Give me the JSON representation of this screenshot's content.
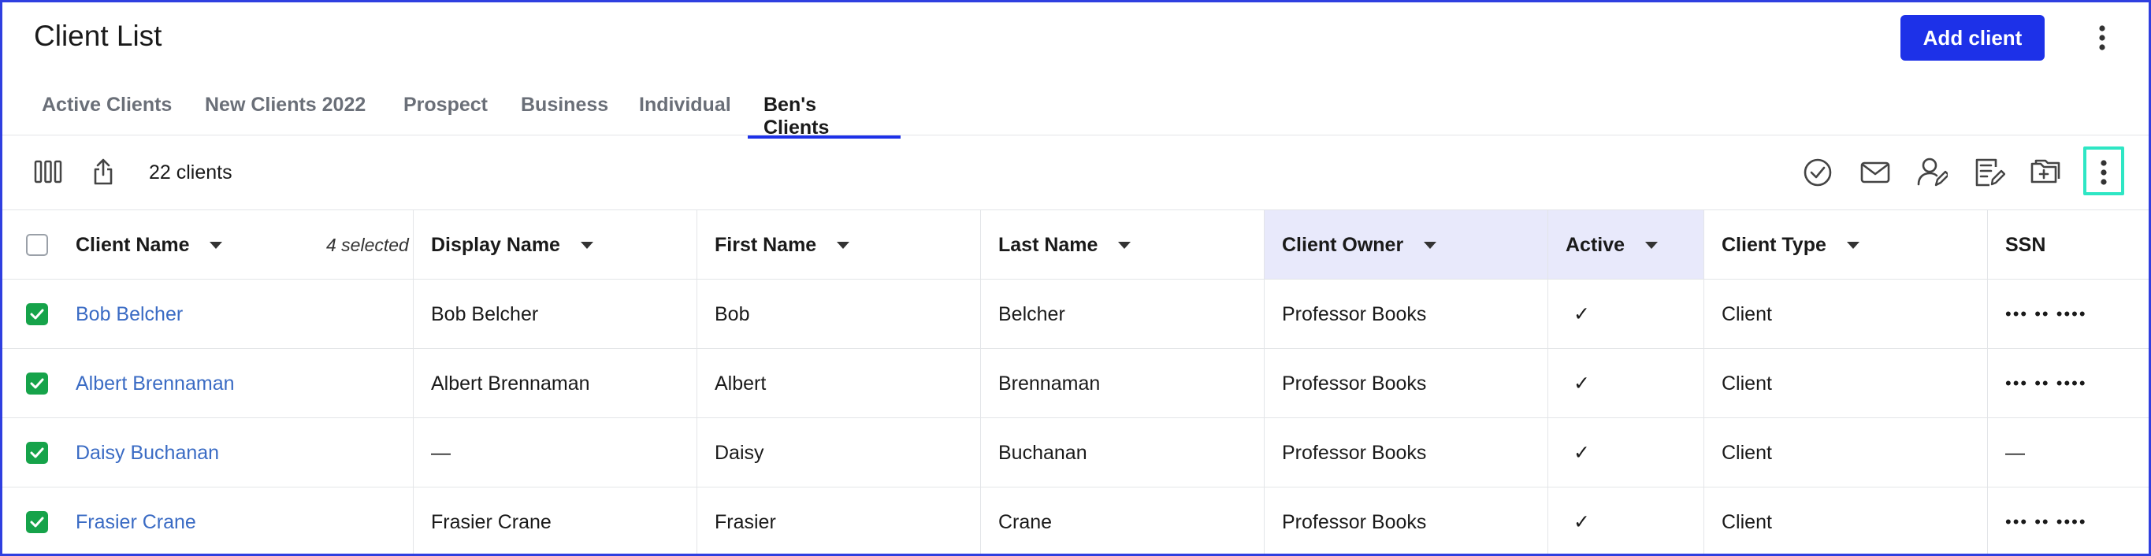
{
  "header": {
    "title": "Client List",
    "add_button_label": "Add client"
  },
  "tabs": [
    {
      "label": "Active Clients"
    },
    {
      "label": "New Clients 2022"
    },
    {
      "label": "Prospect"
    },
    {
      "label": "Business"
    },
    {
      "label": "Individual"
    },
    {
      "label": "Ben's Clients",
      "active": true
    }
  ],
  "toolbar": {
    "count_label": "22 clients",
    "left_icons": [
      "columns-icon",
      "export-icon"
    ],
    "right_icons": [
      "check-circle-icon",
      "mail-icon",
      "assign-user-icon",
      "edit-note-icon",
      "add-folder-icon",
      "more-vertical-icon"
    ]
  },
  "table": {
    "selected_label": "4 selected",
    "columns": [
      "Client Name",
      "Display Name",
      "First Name",
      "Last Name",
      "Client Owner",
      "Active",
      "Client Type",
      "SSN"
    ],
    "rows": [
      {
        "client_name": "Bob Belcher",
        "display_name": "Bob Belcher",
        "first_name": "Bob",
        "last_name": "Belcher",
        "owner": "Professor Books",
        "active": "✓",
        "type": "Client",
        "ssn": "••• •• ••••"
      },
      {
        "client_name": "Albert Brennaman",
        "display_name": "Albert Brennaman",
        "first_name": "Albert",
        "last_name": "Brennaman",
        "owner": "Professor Books",
        "active": "✓",
        "type": "Client",
        "ssn": "••• •• ••••"
      },
      {
        "client_name": "Daisy Buchanan",
        "display_name": "—",
        "first_name": "Daisy",
        "last_name": "Buchanan",
        "owner": "Professor Books",
        "active": "✓",
        "type": "Client",
        "ssn": "—"
      },
      {
        "client_name": "Frasier Crane",
        "display_name": "Frasier Crane",
        "first_name": "Frasier",
        "last_name": "Crane",
        "owner": "Professor Books",
        "active": "✓",
        "type": "Client",
        "ssn": "••• •• ••••"
      }
    ]
  },
  "colors": {
    "accent": "#1d31e8",
    "link": "#3a6bc4",
    "checkbox_checked": "#16a34a",
    "focus_ring": "#2ee6c4",
    "highlight_column": "#e8e9fb"
  }
}
